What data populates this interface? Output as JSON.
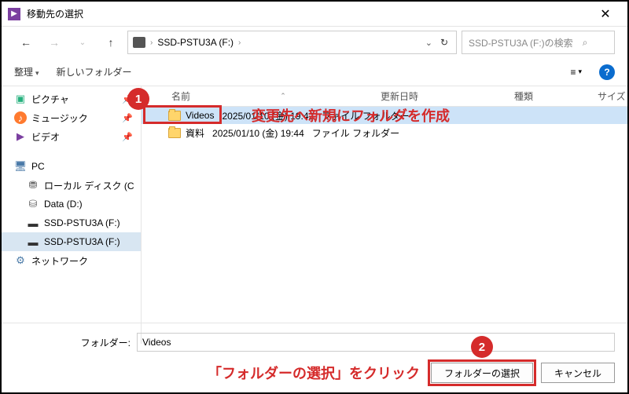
{
  "title": "移動先の選択",
  "close": "✕",
  "nav": {
    "back": "←",
    "forward": "→",
    "up": "↑",
    "chev": "›",
    "refresh": "↻",
    "dropdown": "⌄"
  },
  "address": {
    "drive": "SSD-PSTU3A (F:)"
  },
  "search": {
    "placeholder": "SSD-PSTU3A (F:)の検索"
  },
  "toolbar": {
    "organize": "整理",
    "newfolder": "新しいフォルダー",
    "view": "≡",
    "dd": "▾",
    "help": "?"
  },
  "headers": {
    "name": "名前",
    "date": "更新日時",
    "type": "種類",
    "size": "サイズ",
    "arrow": "⌃"
  },
  "tree": [
    {
      "icon": "ic-pic",
      "glyph": "▣",
      "label": "ピクチャ",
      "pin": true
    },
    {
      "icon": "ic-mus",
      "glyph": "♪",
      "label": "ミュージック",
      "pin": true
    },
    {
      "icon": "ic-vid",
      "glyph": "▶",
      "label": "ビデオ",
      "pin": true
    },
    {
      "sep": true
    },
    {
      "icon": "ic-pc",
      "glyph": "🖥",
      "label": "PC"
    },
    {
      "icon": "ic-drv",
      "glyph": "⛃",
      "label": "ローカル ディスク (C",
      "indent": true
    },
    {
      "icon": "ic-drv",
      "glyph": "⛁",
      "label": "Data (D:)",
      "indent": true
    },
    {
      "icon": "ic-ssd",
      "glyph": "▬",
      "label": "SSD-PSTU3A (F:)",
      "indent": true
    },
    {
      "icon": "ic-ssd",
      "glyph": "▬",
      "label": "SSD-PSTU3A (F:)",
      "indent": true,
      "sel": true
    },
    {
      "icon": "ic-net",
      "glyph": "⚙",
      "label": "ネットワーク"
    }
  ],
  "rows": [
    {
      "name": "Videos",
      "date": "2025/01/10 (金) 19:42",
      "type": "ファイル フォルダー",
      "sel": true
    },
    {
      "name": "資料",
      "date": "2025/01/10 (金) 19:44",
      "type": "ファイル フォルダー"
    }
  ],
  "folder_label": "フォルダー:",
  "folder_value": "Videos",
  "btn_select": "フォルダーの選択",
  "btn_cancel": "キャンセル",
  "annot": {
    "badge1": "1",
    "text1": "変更先へ新規にフォルダを作成",
    "badge2": "2",
    "text2": "「フォルダーの選択」をクリック"
  }
}
